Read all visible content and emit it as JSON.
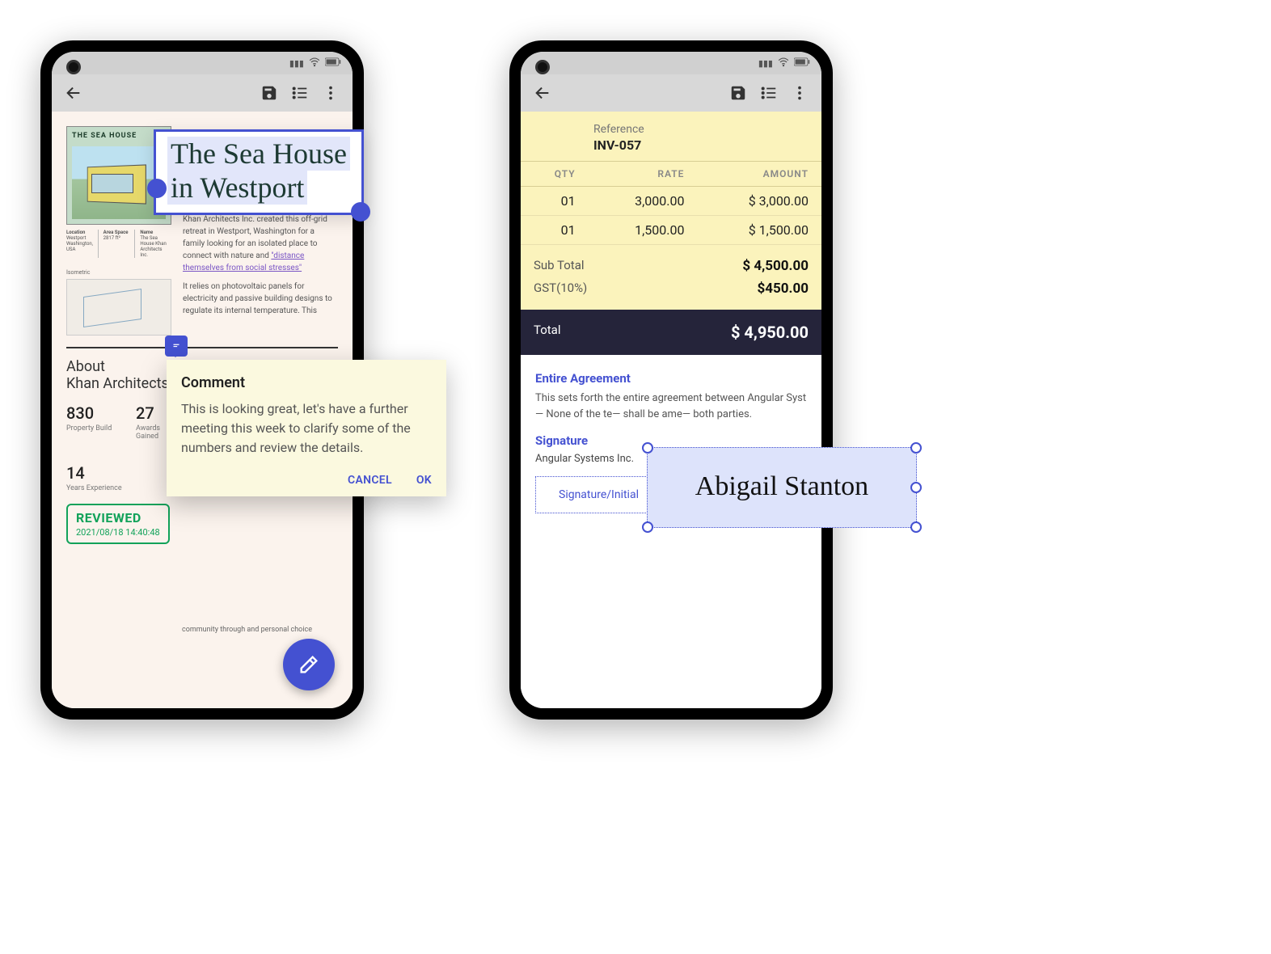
{
  "left_phone": {
    "topbar": {
      "back_aria": "Back",
      "save_aria": "Save",
      "list_aria": "List",
      "more_aria": "More"
    },
    "doc": {
      "img_caption": "THE SEA HOUSE",
      "meta": {
        "c1_lbl": "Location",
        "c1_val": "Westport Washington, USA",
        "c2_lbl": "Area Space",
        "c2_val": "2817 ft²",
        "c3_lbl": "Name",
        "c3_val": "The Sea House Khan Architects Inc."
      },
      "iso_label": "Isometric",
      "para1_pre": "Khan Architects Inc. created this off-grid retreat in Westport, Washington for a family looking for an isolated place to connect with nature and ",
      "para1_link": "\"distance themselves from social stresses\"",
      "para2": "It relies on photovoltaic panels for electricity and passive building designs to regulate its internal temperature. This",
      "about_line1": "About",
      "about_line2": "Khan Architects",
      "stats": [
        {
          "num": "830",
          "lbl": "Property Build"
        },
        {
          "num": "27",
          "lbl": "Awards Gained"
        },
        {
          "num": "14",
          "lbl": "Years Experience"
        }
      ],
      "trail_text": "community through and personal choice",
      "stamp_title": "REVIEWED",
      "stamp_date": "2021/08/18 14:40:48"
    }
  },
  "title_callout": {
    "line1": "The Sea House",
    "line2": "in Westport"
  },
  "comment": {
    "title": "Comment",
    "body": "This is looking great, let's have a further meeting this week to clarify some of the numbers and review the details.",
    "cancel": "CANCEL",
    "ok": "OK"
  },
  "right_phone": {
    "topbar": {
      "back_aria": "Back",
      "save_aria": "Save",
      "list_aria": "List",
      "more_aria": "More"
    },
    "invoice": {
      "ref_label": "Reference",
      "ref_value": "INV-057",
      "headers": {
        "qty": "QTY",
        "rate": "RATE",
        "amount": "AMOUNT"
      },
      "rows": [
        {
          "qty": "01",
          "rate": "3,000.00",
          "amount": "$ 3,000.00"
        },
        {
          "qty": "01",
          "rate": "1,500.00",
          "amount": "$ 1,500.00"
        }
      ],
      "subtotal_lbl": "Sub Total",
      "subtotal_val": "$ 4,500.00",
      "gst_lbl": "GST(10%)",
      "gst_val": "$450.00",
      "total_lbl": "Total",
      "total_val": "$ 4,950.00",
      "agree_h": "Entire Agreement",
      "agree_p": "This sets forth the entire agreement between Angular Syst— None of the te— shall be ame— both parties.",
      "sig_h": "Signature",
      "company": "Angular Systems Inc.",
      "sig_slot": "Signature/Initial"
    }
  },
  "signature_name": "Abigail Stanton"
}
